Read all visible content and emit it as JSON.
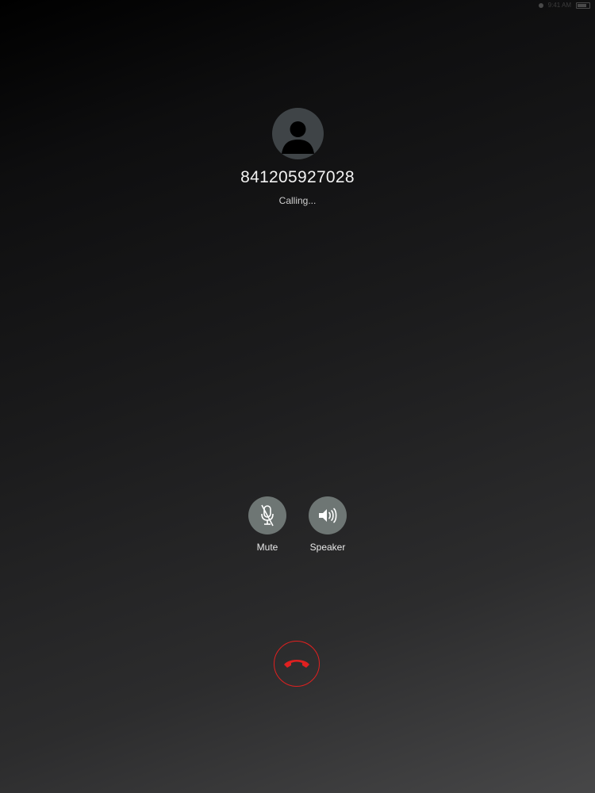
{
  "status_bar": {
    "time": "9:41 AM",
    "wifi_icon": "wifi-icon",
    "battery_icon": "battery-icon"
  },
  "caller": {
    "avatar_icon": "person-silhouette-icon",
    "number": "841205927028",
    "status": "Calling..."
  },
  "controls": {
    "mute": {
      "label": "Mute",
      "icon": "microphone-muted-icon"
    },
    "speaker": {
      "label": "Speaker",
      "icon": "speaker-volume-icon"
    }
  },
  "end_call": {
    "icon": "phone-hangup-icon",
    "color": "#e02020"
  },
  "colors": {
    "background_top": "#000000",
    "background_bottom": "#474748",
    "control_fill": "#6e7674",
    "avatar_fill": "#3f4447",
    "end_call": "#e02020"
  }
}
